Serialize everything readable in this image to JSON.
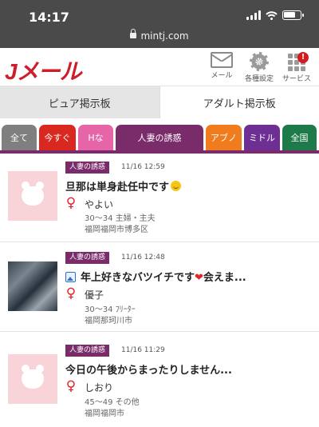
{
  "status_bar": {
    "time": "14:17",
    "battery_level": 0.8
  },
  "browser": {
    "url": "mintj.com"
  },
  "header": {
    "logo": "Jメール",
    "mail_label": "メール",
    "settings_label": "各種設定",
    "services_label": "サービス",
    "services_badge": "!"
  },
  "board_tabs": {
    "pure": "ピュア掲示板",
    "adult": "アダルト掲示板"
  },
  "category_tabs": [
    {
      "label": "全て",
      "color": "#7f7f7f"
    },
    {
      "label": "今すぐ",
      "color": "#d9281f"
    },
    {
      "label": "Hな",
      "color": "#e565a8"
    },
    {
      "label": "人妻の誘惑",
      "color": "#7a2c6a"
    },
    {
      "label": "アブノ",
      "color": "#f07c1e"
    },
    {
      "label": "ミドル",
      "color": "#6d2f93"
    },
    {
      "label": "全国",
      "color": "#1f7a4a"
    }
  ],
  "posts": [
    {
      "category": "人妻の誘惑",
      "date": "11/16 12:59",
      "title": "旦那は単身赴任中です",
      "name": "やよい",
      "profile": "30～34 主婦・主夫",
      "location": "福岡福岡市博多区",
      "thumbnail": "placeholder-bear"
    },
    {
      "category": "人妻の誘惑",
      "date": "11/16 12:48",
      "title": "年上好きなバツイチです",
      "title_suffix": "会えま...",
      "name": "優子",
      "profile": "30～34 ﾌﾘｰﾀｰ",
      "location": "福岡那珂川市",
      "thumbnail": "photo"
    },
    {
      "category": "人妻の誘惑",
      "date": "11/16 11:29",
      "title": "今日の午後からまったりしません...",
      "name": "しおり",
      "profile": "45～49 その他",
      "location": "福岡福岡市",
      "thumbnail": "placeholder-bear"
    }
  ]
}
